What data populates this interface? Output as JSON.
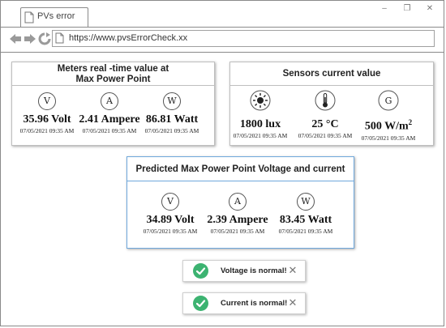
{
  "browser": {
    "tab_title": "PVs error",
    "url": "https://www.pvsErrorCheck.xx"
  },
  "meters": {
    "title_line1": "Meters real -time value at",
    "title_line2": "Max Power Point",
    "items": [
      {
        "symbol": "V",
        "value": "35.96 Volt",
        "date": "07/05/2021 09:35 AM"
      },
      {
        "symbol": "A",
        "value": "2.41 Ampere",
        "date": "07/05/2021 09:35 AM"
      },
      {
        "symbol": "W",
        "value": "86.81 Watt",
        "date": "07/05/2021 09:35 AM"
      }
    ]
  },
  "sensors": {
    "title": "Sensors current value",
    "items": [
      {
        "icon": "sun-icon",
        "value": "1800 lux",
        "date": "07/05/2021 09:35 AM"
      },
      {
        "icon": "thermometer-icon",
        "value": "25 °C",
        "date": "07/05/2021 09:35 AM"
      },
      {
        "icon": "irradiance-g-icon",
        "symbol": "G",
        "value": "500 W/m",
        "superscript": "2",
        "date": "07/05/2021 09:35 AM"
      }
    ]
  },
  "predicted": {
    "title": "Predicted Max Power Point Voltage and current",
    "items": [
      {
        "symbol": "V",
        "value": "34.89 Volt",
        "date": "07/05/2021 09:35 AM"
      },
      {
        "symbol": "A",
        "value": "2.39 Ampere",
        "date": "07/05/2021 09:35 AM"
      },
      {
        "symbol": "W",
        "value": "83.45 Watt",
        "date": "07/05/2021 09:35 AM"
      }
    ]
  },
  "notifications": [
    {
      "text": "Voltage is normal!",
      "color": "#3cb371"
    },
    {
      "text": "Current is normal!",
      "color": "#3cb371"
    }
  ]
}
